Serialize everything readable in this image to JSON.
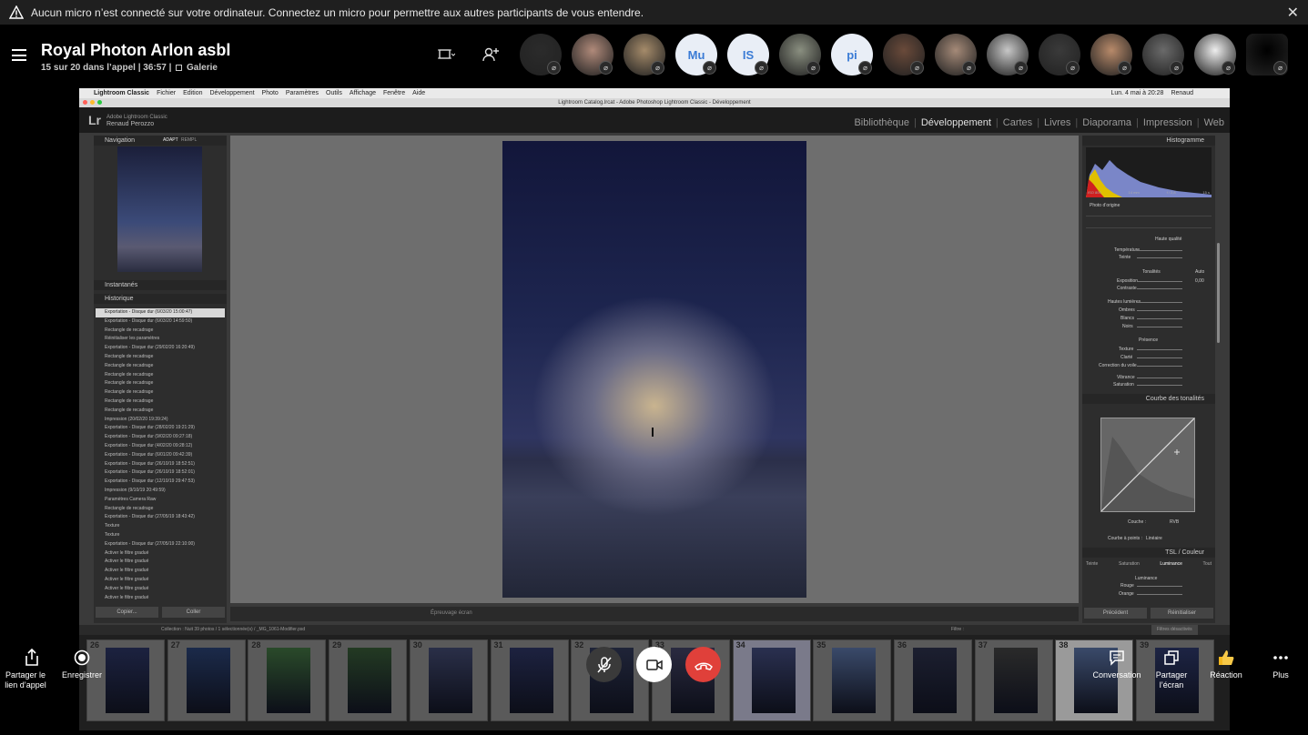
{
  "banner": {
    "text": "Aucun micro n’est connecté sur votre ordinateur. Connectez un micro pour permettre aux autres participants de vous entendre.",
    "close": "✕"
  },
  "meeting": {
    "title": "Royal Photon Arlon asbl",
    "status": "15 sur 20 dans l’appel | 36:57 |",
    "view": "Galerie"
  },
  "participants": [
    {
      "initials": "",
      "color": "#2b2b2b"
    },
    {
      "initials": "",
      "color": "#b08a7a"
    },
    {
      "initials": "",
      "color": "#a58b6a"
    },
    {
      "initials": "Mu",
      "color": "#e9eef6"
    },
    {
      "initials": "IS",
      "color": "#e9eef6"
    },
    {
      "initials": "",
      "color": "#8a8f80"
    },
    {
      "initials": "pi",
      "color": "#e9eef6"
    },
    {
      "initials": "",
      "color": "#6a4a3a"
    },
    {
      "initials": "",
      "color": "#a58a78"
    },
    {
      "initials": "",
      "color": "#c7c7c7"
    },
    {
      "initials": "",
      "color": "#3a3a3a"
    },
    {
      "initials": "",
      "color": "#b88a6a"
    },
    {
      "initials": "",
      "color": "#6a6a6a"
    },
    {
      "initials": "",
      "color": "#eeeeee"
    },
    {
      "initials": "",
      "color": "#000000"
    }
  ],
  "mac": {
    "menus": [
      "Lightroom Classic",
      "Fichier",
      "Edition",
      "Développement",
      "Photo",
      "Paramètres",
      "Outils",
      "Affichage",
      "Fenêtre",
      "Aide"
    ],
    "clock": "Lun. 4 mai à 20:28",
    "user": "Renaud",
    "window_title": "Lightroom Catalog.lrcat - Adobe Photoshop Lightroom Classic - Développement"
  },
  "lightroom": {
    "logo": "Lr",
    "app_name": "Adobe Lightroom Classic",
    "user_name": "Renaud Perozzo",
    "modules": [
      "Bibliothèque",
      "Développement",
      "Cartes",
      "Livres",
      "Diaporama",
      "Impression",
      "Web"
    ],
    "active_module": "Développement",
    "navigator": "Navigation",
    "nav_fit": "ADAPT",
    "nav_zoom": "REMPL",
    "snapshots": "Instantanés",
    "history": "Historique",
    "history_items": [
      "Exportation - Disque dur (6/03/20 15:00:47)",
      "Exportation - Disque dur (6/03/20 14:59:50)",
      "Rectangle de recadrage",
      "Réinitialiser les paramètres",
      "Exportation - Disque dur (29/02/20 16:20:49)",
      "Rectangle de recadrage",
      "Rectangle de recadrage",
      "Rectangle de recadrage",
      "Rectangle de recadrage",
      "Rectangle de recadrage",
      "Rectangle de recadrage",
      "Rectangle de recadrage",
      "Impression (20/02/20 19:39:24)",
      "Exportation - Disque dur (28/02/20 19:21:29)",
      "Exportation - Disque dur (9/02/20 09:27:18)",
      "Exportation - Disque dur (4/02/20 09:28:12)",
      "Exportation - Disque dur (6/01/20 09:42:39)",
      "Exportation - Disque dur (26/10/19 18:52:51)",
      "Exportation - Disque dur (26/10/19 18:52:01)",
      "Exportation - Disque dur (12/10/19 29:47:53)",
      "Impression (9/10/19 20:49:59)",
      "Paramètres Camera Raw",
      "Rectangle de recadrage",
      "Exportation - Disque dur (27/05/19 18:43:42)",
      "Texture",
      "Texture",
      "Exportation - Disque dur (27/05/19 22:10:00)",
      "Activer le filtre gradué",
      "Activer le filtre gradué",
      "Activer le filtre gradué",
      "Activer le filtre gradué",
      "Activer le filtre gradué",
      "Activer le filtre gradué"
    ],
    "copy_btn": "Copier...",
    "paste_btn": "Coller",
    "histogram": "Histogramme",
    "hist_values": [
      "ISO 800",
      "14 mm",
      "f / 2,8",
      "15 s"
    ],
    "original_photo": "Photo d’origine",
    "basic": {
      "profile": "Haute qualité",
      "temp": "Température",
      "tint": "Teinte",
      "tone": "Tonalités",
      "tone_auto": "Auto",
      "exposure": "Exposition",
      "exposure_val": "0,00",
      "contrast": "Contraste",
      "highlights": "Hautes lumières",
      "shadows": "Ombres",
      "whites": "Blancs",
      "blacks": "Noirs",
      "presence": "Présence",
      "texture": "Texture",
      "clarity": "Clarté",
      "dehaze": "Correction du voile",
      "vibrance": "Vibrance",
      "saturation": "Saturation"
    },
    "tone_curve": "Courbe des tonalités",
    "channel_label": "Couche :",
    "channel": "RVB",
    "point_curve_label": "Courbe à points :",
    "point_curve": "Linéaire",
    "hsl": "TSL / Couleur",
    "hsl_tabs": [
      "Teinte",
      "Saturation",
      "Luminance",
      "Tout"
    ],
    "luminance": "Luminance",
    "red": "Rouge",
    "orange": "Orange",
    "previous_btn": "Précédent",
    "reset_btn": "Réinitialiser",
    "softproof": "Épreuvage écran",
    "filmstrip_path": "Collection : Nuit   39 photos / 1 sélectionnée(s) / _MG_1061-Modifier.psd",
    "filter_label": "Filtre :",
    "filter": "Filtres désactivés",
    "film_numbers": [
      "26",
      "27",
      "28",
      "29",
      "30",
      "31",
      "32",
      "33",
      "34",
      "35",
      "36",
      "37",
      "38",
      "39"
    ]
  },
  "controls": {
    "share_link": "Partager le lien d’appel",
    "record": "Enregistrer",
    "chat": "Conversation",
    "share_screen": "Partager l’écran",
    "reaction": "Réaction",
    "more": "Plus"
  }
}
